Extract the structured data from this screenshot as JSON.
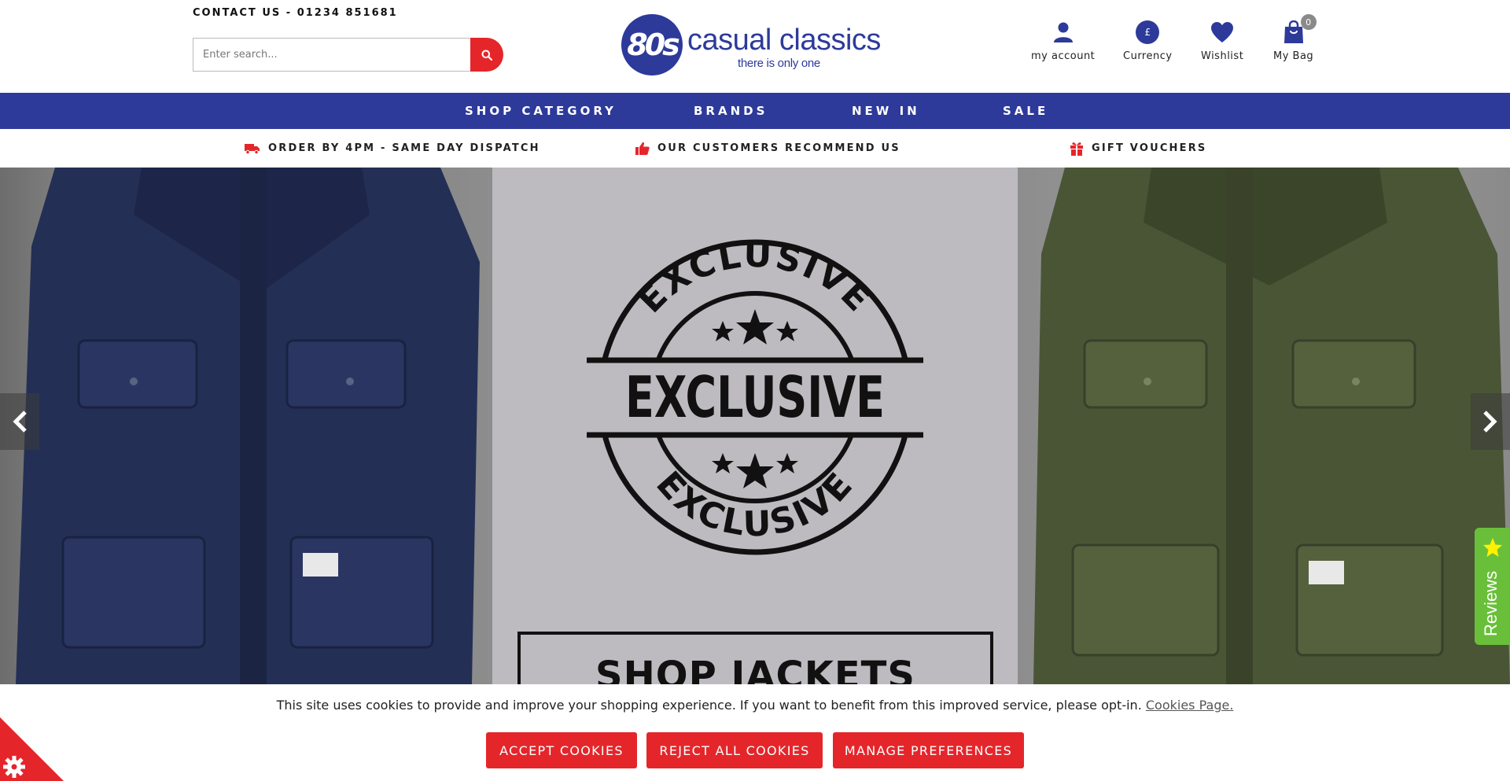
{
  "header": {
    "contact": "CONTACT US - 01234 851681",
    "search": {
      "placeholder": "Enter search..."
    },
    "logo": {
      "mark": "80s",
      "name": "casual classics",
      "tagline": "there is only one"
    },
    "utility": {
      "account_label": "my account",
      "currency_label": "Currency",
      "currency_symbol": "£",
      "wishlist_label": "Wishlist",
      "bag_label": "My Bag",
      "bag_count": "0"
    }
  },
  "nav": {
    "items": [
      {
        "label": "SHOP CATEGORY"
      },
      {
        "label": "BRANDS"
      },
      {
        "label": "NEW IN"
      },
      {
        "label": "SALE"
      }
    ]
  },
  "usp": {
    "items": [
      {
        "label": "ORDER BY 4PM - SAME DAY DISPATCH",
        "icon": "truck-icon"
      },
      {
        "label": "OUR CUSTOMERS RECOMMEND US",
        "icon": "thumbs-up-icon"
      },
      {
        "label": "GIFT VOUCHERS",
        "icon": "gift-icon"
      }
    ]
  },
  "hero": {
    "badge_top": "EXCLUSIVE",
    "badge_middle": "EXCLUSIVE",
    "badge_bottom": "EXCLUSIVE",
    "cta": "SHOP JACKETS"
  },
  "reviews_tab": {
    "label": "Reviews"
  },
  "cookie": {
    "message": "This site uses cookies to provide and improve your shopping experience. If you want to benefit from this improved service, please opt-in.",
    "link": "Cookies Page.",
    "accept": "ACCEPT COOKIES",
    "reject": "REJECT ALL COOKIES",
    "manage": "MANAGE PREFERENCES"
  },
  "colors": {
    "brand_blue": "#2d3a9a",
    "accent_red": "#e4262b",
    "reviews_green": "#6abf3a"
  }
}
